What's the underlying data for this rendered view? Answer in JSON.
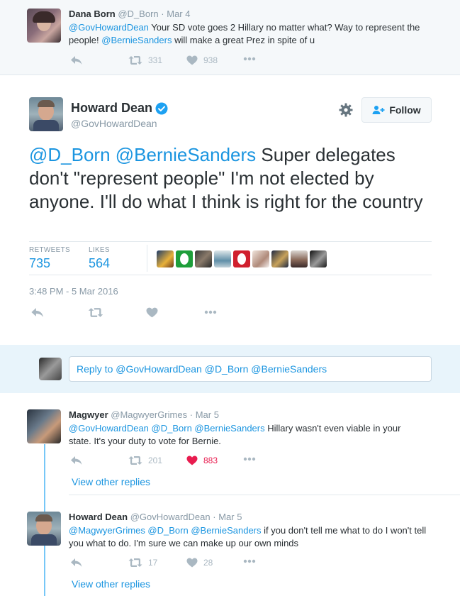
{
  "ancestor": {
    "name": "Dana Born",
    "handle": "@D_Born",
    "time": "Mar 4",
    "text_mention": "@GovHowardDean",
    "text_part1": " Your SD vote goes 2 Hillary no matter what? Way to represent the people! ",
    "text_mention2": "@BernieSanders",
    "text_part2": " will make a great Prez in spite of u",
    "retweets": "331",
    "likes": "938"
  },
  "main": {
    "name": "Howard Dean",
    "handle": "@GovHowardDean",
    "follow_label": "Follow",
    "text_mentions": "@D_Born @BernieSanders",
    "text_body": " Super delegates don't \"represent people\" I'm not elected  by anyone. I'll do what I think is right for the country",
    "retweets_label": "RETWEETS",
    "retweets": "735",
    "likes_label": "LIKES",
    "likes": "564",
    "timestamp": "3:48 PM - 5 Mar 2016"
  },
  "reply_box": {
    "placeholder": "Reply to @GovHowardDean @D_Born @BernieSanders"
  },
  "replies": [
    {
      "name": "Magwyer",
      "handle": "@MagwyerGrimes",
      "time": "Mar 5",
      "mentions": "@GovHowardDean @D_Born @BernieSanders",
      "text": " Hillary wasn't even viable in your state. It's your duty to vote for Bernie.",
      "retweets": "201",
      "likes": "883",
      "view_other": "View other replies"
    },
    {
      "name": "Howard Dean",
      "handle": "@GovHowardDean",
      "time": "Mar 5",
      "mentions": "@MagwyerGrimes @D_Born @BernieSanders",
      "text": " if you don't tell me what to do I won't tell you what to do. I'm sure we can make up our own minds",
      "retweets": "17",
      "likes": "28",
      "view_other": "View other replies"
    }
  ],
  "colors": {
    "link": "#1b95e0",
    "liked": "#e81c4f",
    "verified": "#1da1f2",
    "muted": "#8899a6"
  }
}
